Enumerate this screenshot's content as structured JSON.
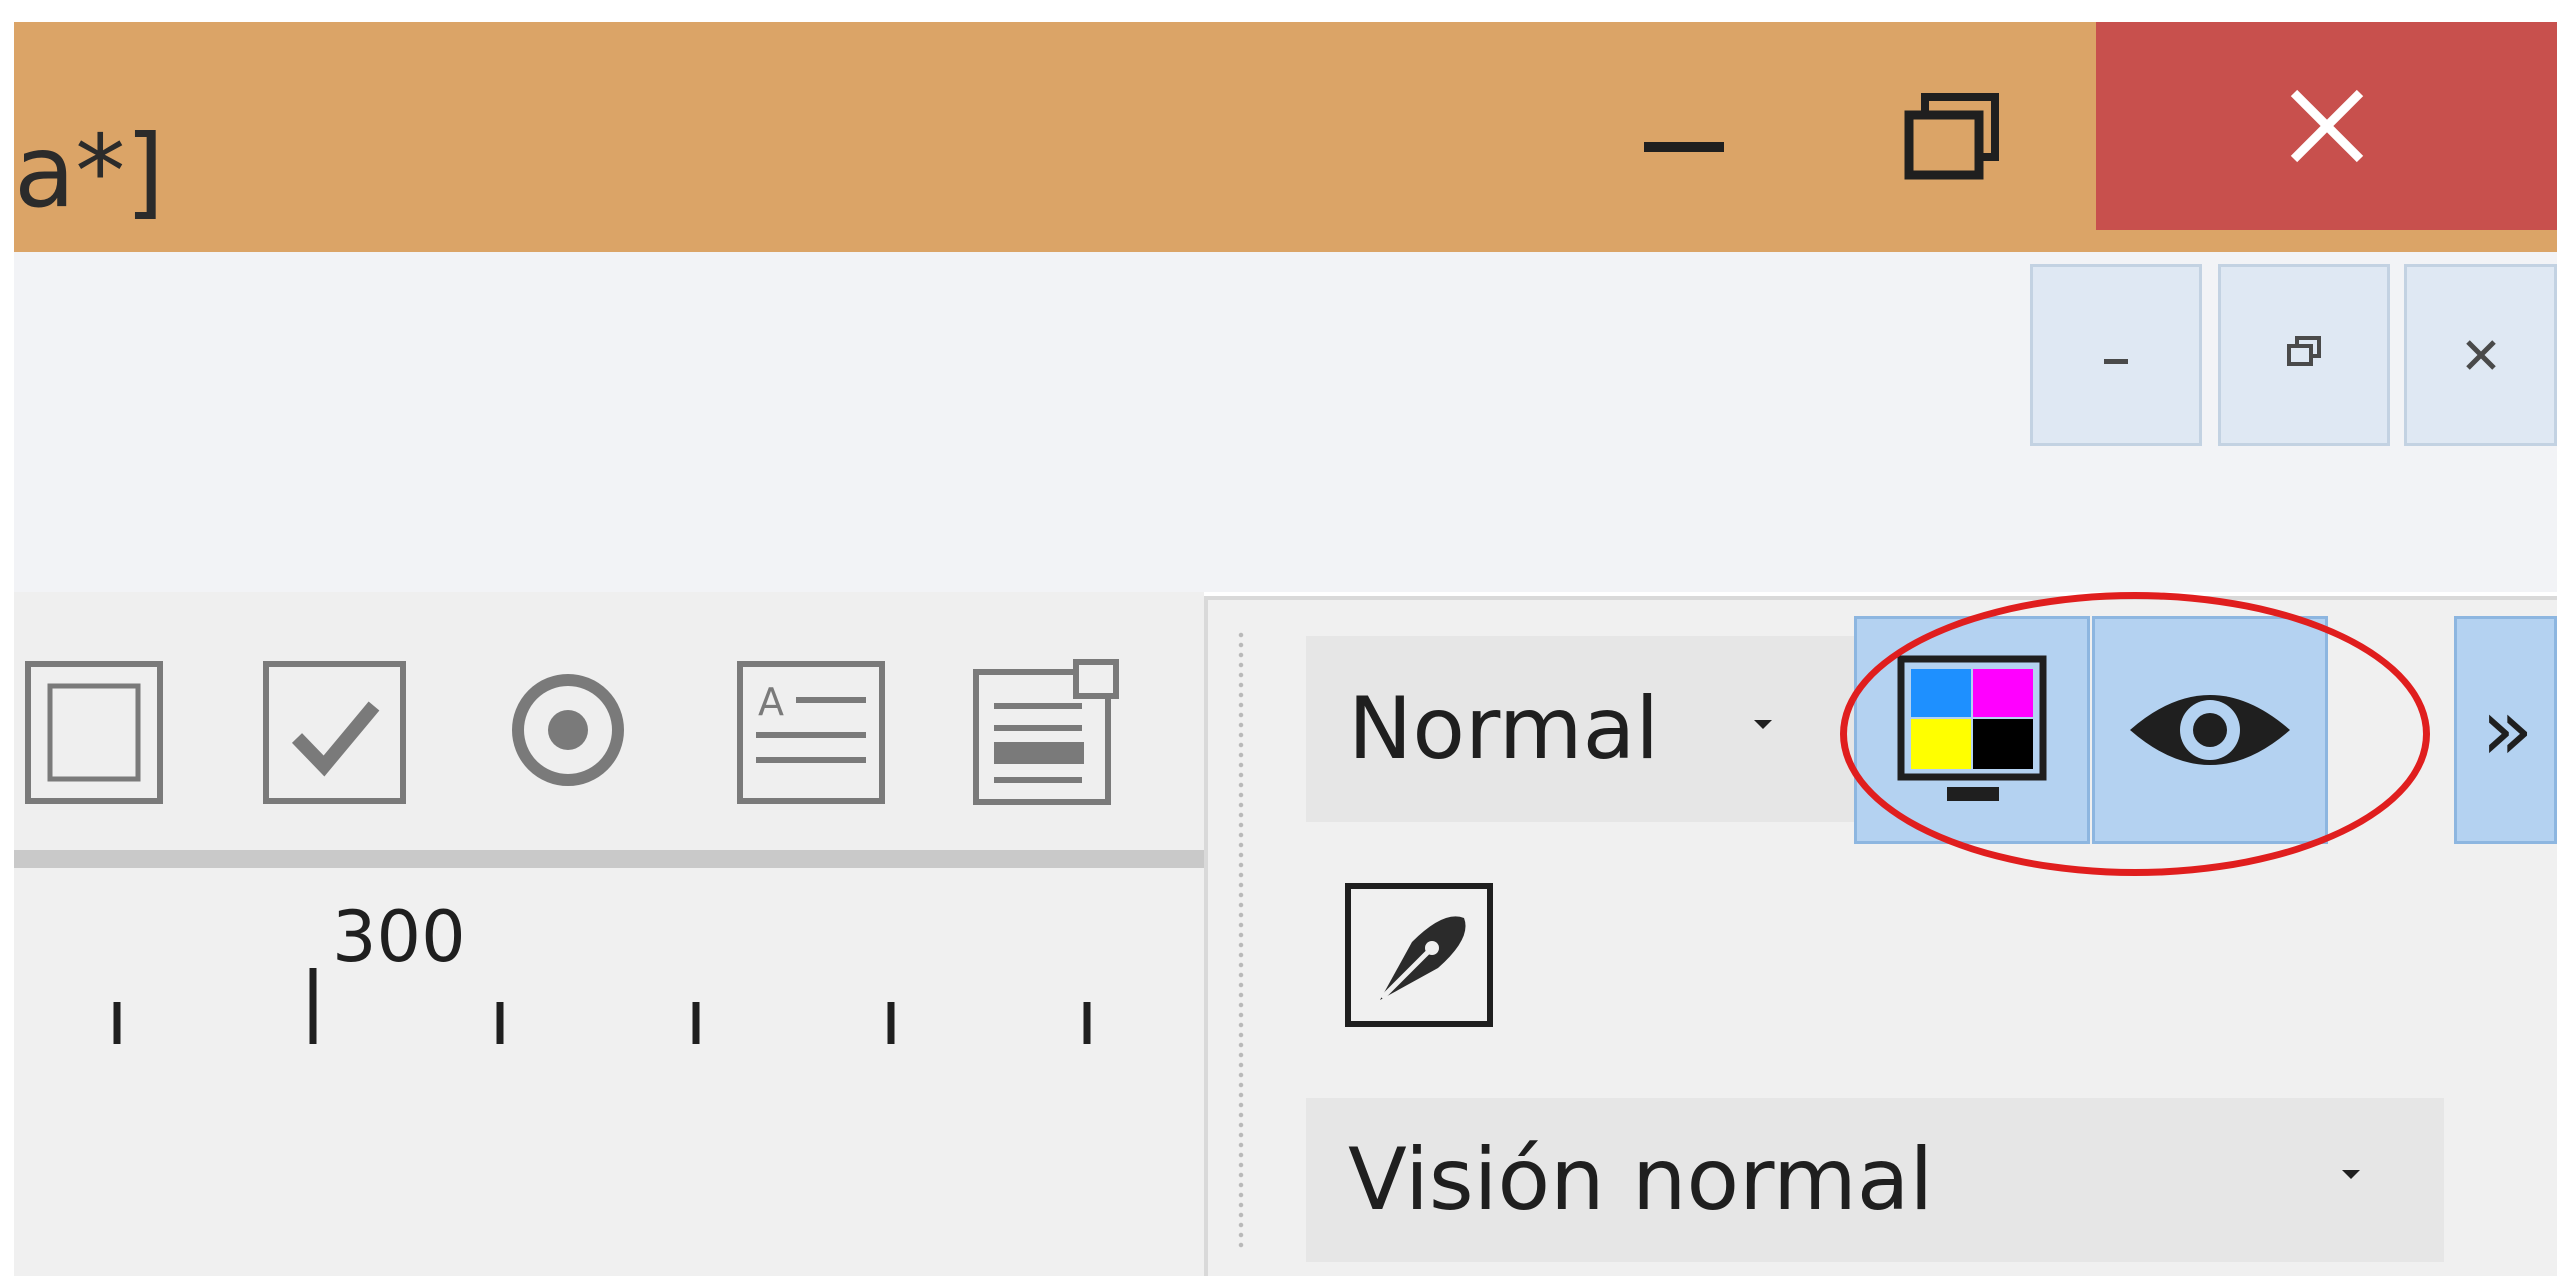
{
  "window": {
    "title_fragment": "a*]",
    "title_bar_color": "#dba467",
    "close_button_color": "#c8504d"
  },
  "window_controls": [
    {
      "name": "minimize-icon"
    },
    {
      "name": "restore-icon"
    },
    {
      "name": "close-icon"
    }
  ],
  "mdi_controls": [
    {
      "name": "mdi-minimize-icon"
    },
    {
      "name": "mdi-restore-icon"
    },
    {
      "name": "mdi-close-icon"
    }
  ],
  "form_tools": [
    {
      "name": "frame-icon"
    },
    {
      "name": "checkbox-icon"
    },
    {
      "name": "radio-button-icon"
    },
    {
      "name": "text-field-icon"
    },
    {
      "name": "list-box-icon"
    }
  ],
  "ruler": {
    "label": "300"
  },
  "view_toolbar": {
    "mode_combo_value": "Normal",
    "color_display_button": "color-display-icon",
    "preview_button": "eye-icon",
    "overflow_label": "»",
    "edit_button": "pen-nib-icon",
    "vision_combo_value": "Visión normal",
    "highlight_color": "#e01e1e",
    "button_active_color": "#b4d2f1"
  }
}
